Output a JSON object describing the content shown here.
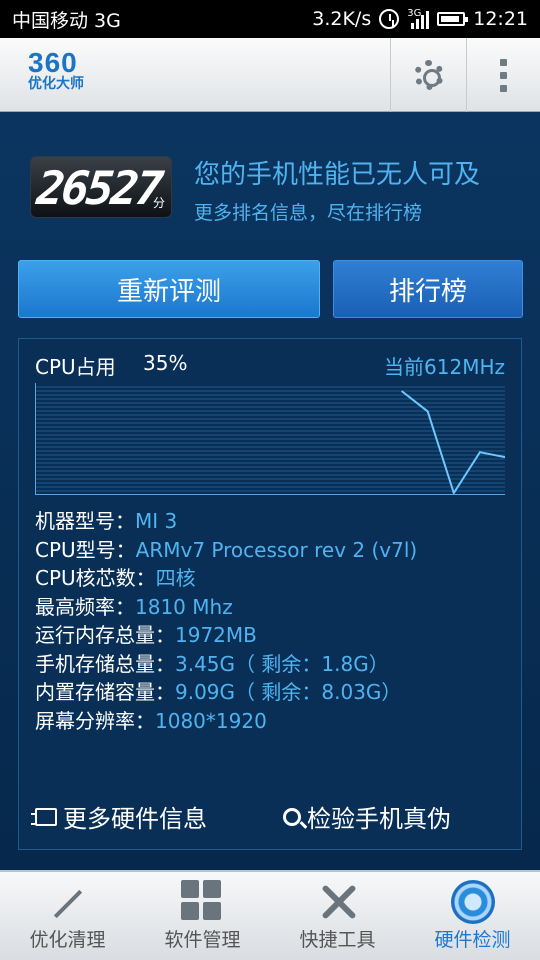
{
  "status_bar": {
    "carrier": "中国移动 3G",
    "speed": "3.2K/s",
    "network_badge": "3G",
    "time": "12:21"
  },
  "app": {
    "logo_number": "360",
    "logo_text": "优化大师"
  },
  "score": {
    "value": "26527",
    "unit": "分",
    "headline": "您的手机性能已无人可及",
    "subline": "更多排名信息，尽在排行榜"
  },
  "actions": {
    "retest_label": "重新评测",
    "ranking_label": "排行榜"
  },
  "cpu": {
    "label": "CPU占用",
    "usage": "35%",
    "frequency": "当前612MHz"
  },
  "chart_data": {
    "type": "line",
    "series": [
      {
        "values": [
          null,
          null,
          null,
          null,
          null,
          null,
          null,
          null,
          null,
          null,
          null,
          null,
          null,
          null,
          100,
          80,
          0,
          40,
          35
        ]
      }
    ],
    "ylim": [
      0,
      100
    ]
  },
  "specs": [
    {
      "key": "机器型号：",
      "value": "MI 3"
    },
    {
      "key": "CPU型号：",
      "value": "ARMv7 Processor rev 2 (v7l)"
    },
    {
      "key": "CPU核芯数：",
      "value": "四核"
    },
    {
      "key": "最高频率：",
      "value": "1810 Mhz"
    },
    {
      "key": "运行内存总量：",
      "value": "1972MB"
    },
    {
      "key": "手机存储总量：",
      "value": "3.45G（ 剩余：1.8G）"
    },
    {
      "key": "内置存储容量：",
      "value": "9.09G（ 剩余：8.03G）"
    },
    {
      "key": "屏幕分辨率：",
      "value": "1080*1920"
    }
  ],
  "links": {
    "more_hardware": "更多硬件信息",
    "verify_phone": "检验手机真伪"
  },
  "bottom_nav": [
    {
      "label": "优化清理",
      "icon": "magic-wand-icon"
    },
    {
      "label": "软件管理",
      "icon": "grid-icon"
    },
    {
      "label": "快捷工具",
      "icon": "tools-icon"
    },
    {
      "label": "硬件检测",
      "icon": "radar-icon",
      "active": true
    }
  ],
  "colors": {
    "accent": "#4fb3f0",
    "background": "#06284c",
    "button": "#2a8ee0"
  }
}
